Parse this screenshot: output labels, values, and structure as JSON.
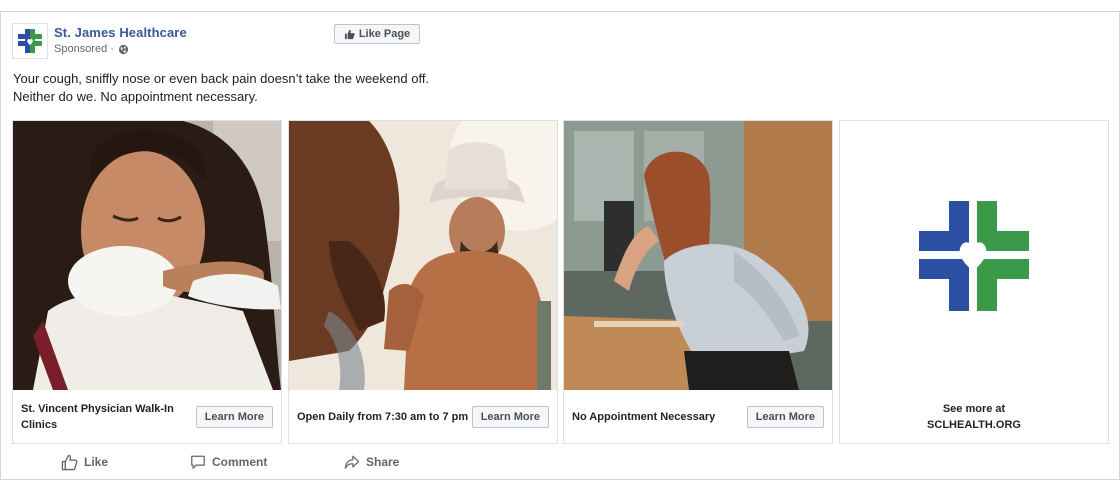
{
  "page": {
    "name": "St. James Healthcare",
    "sponsored_label": "Sponsored · ",
    "like_page_label": "Like Page"
  },
  "post": {
    "text_line1": "Your cough, sniffly nose or even back pain doesn’t take the weekend off.",
    "text_line2": "Neither do we. No appointment necessary."
  },
  "carousel": {
    "cards": [
      {
        "title": "St. Vincent Physician Walk-In Clinics",
        "button": "Learn More",
        "image": "woman coughing into elbow"
      },
      {
        "title": "Open Daily from 7:30 am to 7 pm",
        "button": "Learn More",
        "image": "cowboy petting horse"
      },
      {
        "title": "No Appointment Necessary",
        "button": "Learn More",
        "image": "woman with back pain at desk"
      }
    ],
    "end_card": {
      "line1": "See more at",
      "line2": "SCLHEALTH.ORG"
    }
  },
  "actions": {
    "like": "Like",
    "comment": "Comment",
    "share": "Share"
  },
  "colors": {
    "logo_blue": "#2a4fa3",
    "logo_green": "#3a9a4a",
    "link_blue": "#385898"
  },
  "icons": [
    "globe-icon",
    "thumbs-up-icon",
    "comment-icon",
    "share-icon",
    "cross-heart-logo"
  ]
}
